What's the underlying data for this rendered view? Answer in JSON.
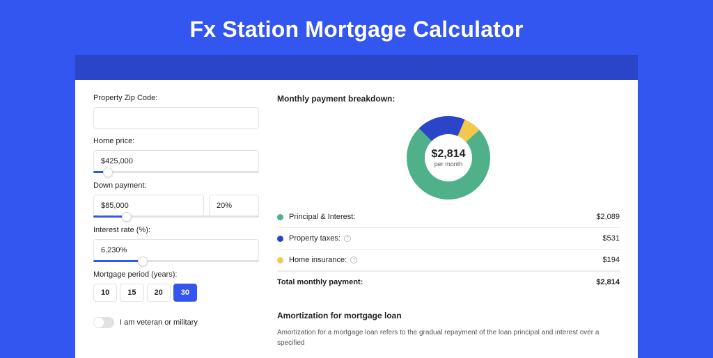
{
  "title": "Fx Station Mortgage Calculator",
  "left": {
    "zip_label": "Property Zip Code:",
    "zip_value": "",
    "home_price_label": "Home price:",
    "home_price_value": "$425,000",
    "home_price_slider_pct": 9,
    "down_payment_label": "Down payment:",
    "down_payment_value": "$85,000",
    "down_payment_pct": "20%",
    "down_payment_slider_pct": 20,
    "interest_label": "Interest rate (%):",
    "interest_value": "6.230%",
    "interest_slider_pct": 30,
    "period_label": "Mortgage period (years):",
    "periods": [
      "10",
      "15",
      "20",
      "30"
    ],
    "period_active": "30",
    "veteran_label": "I am veteran or military",
    "veteran_on": false
  },
  "right": {
    "section_title": "Monthly payment breakdown:",
    "donut_amount": "$2,814",
    "donut_sub": "per month",
    "items": [
      {
        "label": "Principal & Interest:",
        "value": "$2,089",
        "color": "#4fb08a",
        "info": false
      },
      {
        "label": "Property taxes:",
        "value": "$531",
        "color": "#2a45c8",
        "info": true
      },
      {
        "label": "Home insurance:",
        "value": "$194",
        "color": "#f2c94c",
        "info": true
      }
    ],
    "total_label": "Total monthly payment:",
    "total_value": "$2,814",
    "amort_title": "Amortization for mortgage loan",
    "amort_text": "Amortization for a mortgage loan refers to the gradual repayment of the loan principal and interest over a specified"
  },
  "chart_data": {
    "type": "pie",
    "title": "Monthly payment breakdown",
    "series": [
      {
        "name": "Principal & Interest",
        "value": 2089,
        "color": "#4fb08a"
      },
      {
        "name": "Property taxes",
        "value": 531,
        "color": "#2a45c8"
      },
      {
        "name": "Home insurance",
        "value": 194,
        "color": "#f2c94c"
      }
    ],
    "total": 2814,
    "center_label": "$2,814 per month"
  }
}
